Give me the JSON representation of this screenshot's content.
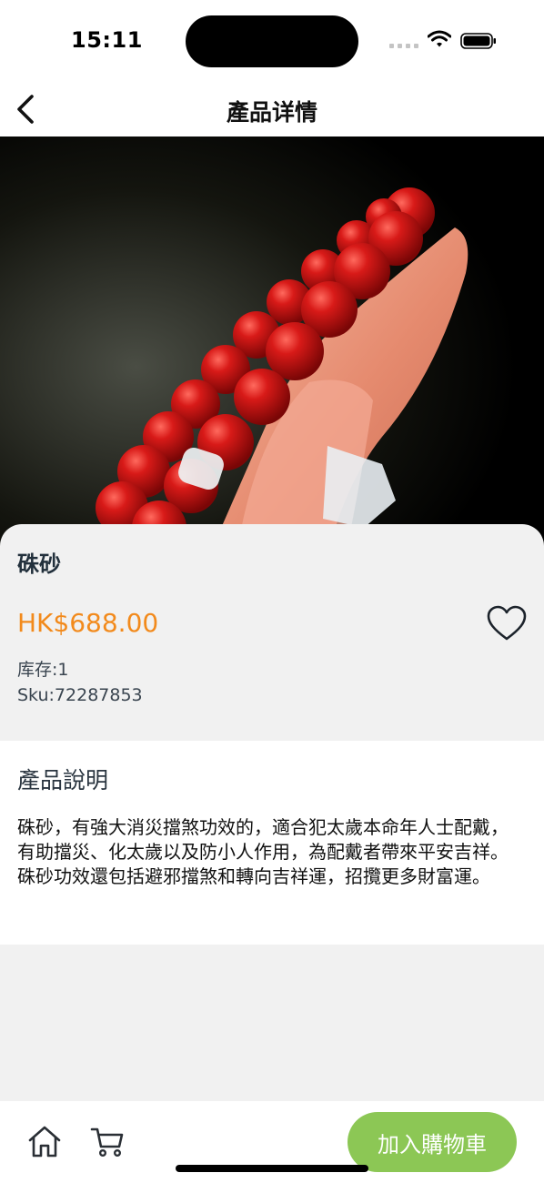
{
  "status_bar": {
    "time": "15:11",
    "icons": [
      "signal-icon",
      "wifi-icon",
      "battery-icon"
    ]
  },
  "nav": {
    "title": "產品详情",
    "back_icon": "chevron-left-icon"
  },
  "product": {
    "image_alt": "red-bead-bracelet-photo",
    "name": "硃砂",
    "price": "HK$688.00",
    "stock": "库存:1",
    "sku": "Sku:72287853",
    "favorite_icon": "heart-outline-icon"
  },
  "description": {
    "title": "產品說明",
    "text": "硃砂，有強大消災擋煞功效的，適合犯太歲本命年人士配戴，有助擋災、化太歲以及防小人作用，為配戴者帶來平安吉祥。 硃砂功效還包括避邪擋煞和轉向吉祥運，招攬更多財富運。"
  },
  "bottom_bar": {
    "home_icon": "home-icon",
    "cart_icon": "cart-icon",
    "add_to_cart_label": "加入購物車"
  },
  "colors": {
    "price": "#f28a1c",
    "accent_button": "#8cc755",
    "background": "#f1f1f1"
  }
}
